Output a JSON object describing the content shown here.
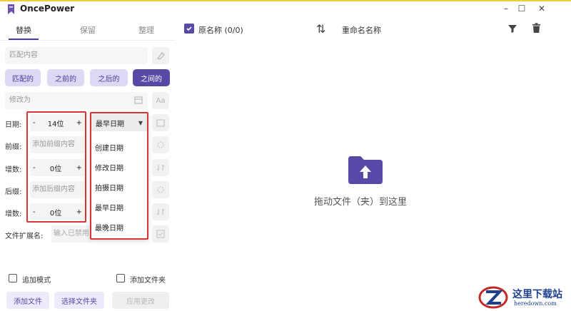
{
  "window": {
    "title": "OncePower",
    "minimize": "–",
    "maximize": "☐",
    "close": "✕"
  },
  "tabs": [
    "替换",
    "保留",
    "整理"
  ],
  "active_tab": "替换",
  "match_placeholder": "匹配内容",
  "match_chips": [
    "匹配的",
    "之前的",
    "之后的",
    "之间的"
  ],
  "active_chip": "之间的",
  "modify_placeholder": "修改为",
  "aa_label": "Aa",
  "rows": {
    "date_label": "日期:",
    "date_value": "14位",
    "prefix_label": "前缀:",
    "prefix_placeholder": "添加前缀内容",
    "increment1_label": "增数:",
    "increment1_value": "0位",
    "suffix_label": "后缀:",
    "suffix_placeholder": "添加后缀内容",
    "increment2_label": "增数:",
    "increment2_value": "0位",
    "minus": "-",
    "plus": "+"
  },
  "ext_label": "文件扩展名:",
  "ext_placeholder": "输入已禁用",
  "date_select": {
    "selected": "最早日期",
    "options": [
      "创建日期",
      "修改日期",
      "拍摄日期",
      "最早日期",
      "最晚日期"
    ]
  },
  "checks": {
    "append_mode": "追加模式",
    "add_folder": "添加文件夹"
  },
  "buttons": {
    "add_file": "添加文件",
    "select_folder": "选择文件夹",
    "apply": "应用更改"
  },
  "header": {
    "original_name": "原名称 (0/0)",
    "sort_icon": "⇅",
    "rename_name": "重命名名称"
  },
  "drop_text": "拖动文件（夹）到这里",
  "watermark": {
    "name": "这里下载站",
    "url": "heredown.com"
  },
  "colors": {
    "accent": "#5a48a6",
    "chip_bg": "#ddd8f3",
    "highlight_red": "#d93535",
    "top_border": "#f2cf3a"
  }
}
